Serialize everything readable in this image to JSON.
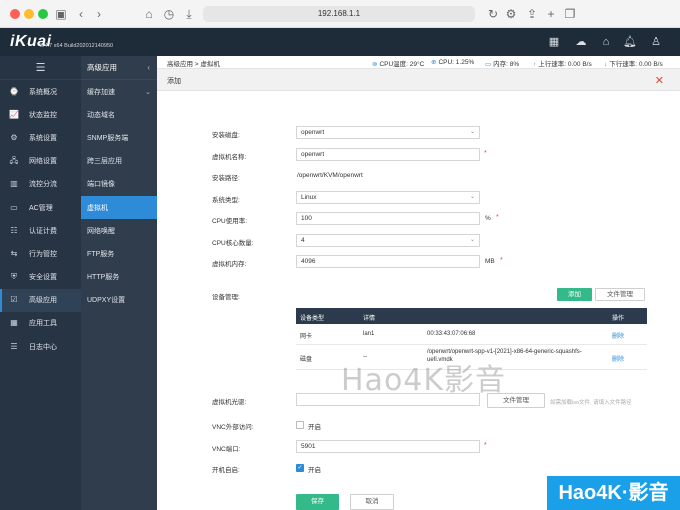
{
  "browser": {
    "url": "192.168.1.1"
  },
  "app": {
    "logo": "iKuai",
    "version": "3.4.7 x64 Build202012140950"
  },
  "sidebar": {
    "items": [
      {
        "label": "系统概况",
        "icon": "⌚"
      },
      {
        "label": "状态监控",
        "icon": "📈"
      },
      {
        "label": "系统设置",
        "icon": "⚙"
      },
      {
        "label": "网络设置",
        "icon": "🖧"
      },
      {
        "label": "流控分流",
        "icon": "▥"
      },
      {
        "label": "AC管理",
        "icon": "▭"
      },
      {
        "label": "认证计费",
        "icon": "☷"
      },
      {
        "label": "行为管控",
        "icon": "⇆"
      },
      {
        "label": "安全设置",
        "icon": "⛨"
      },
      {
        "label": "高级应用",
        "icon": "☑"
      },
      {
        "label": "应用工具",
        "icon": "▦"
      },
      {
        "label": "日志中心",
        "icon": "☰"
      }
    ]
  },
  "submenu": {
    "title": "高级应用",
    "items": [
      "缓存加速",
      "动态域名",
      "SNMP服务端",
      "跨三层应用",
      "端口镜像",
      "虚拟机",
      "网络唤醒",
      "FTP服务",
      "HTTP服务",
      "UDPXY设置"
    ]
  },
  "statusbar": {
    "breadcrumb": "高级应用 > 虚拟机",
    "cpu_temp": "CPU温度: 29°C",
    "cpu": "CPU: 1.25%",
    "mem": "内存: 8%",
    "up": "上行速率: 0.00 B/s",
    "down": "下行速率: 0.00 B/s"
  },
  "panel": {
    "title": "添加"
  },
  "form": {
    "disk_label": "安装磁盘:",
    "disk_value": "openwrt",
    "name_label": "虚拟机名称:",
    "name_value": "openwrt",
    "path_label": "安装路径:",
    "path_value": "/openwrt/KVM/openwrt",
    "os_label": "系统类型:",
    "os_value": "Linux",
    "cpu_label": "CPU使用率:",
    "cpu_value": "100",
    "cpu_unit": "%",
    "cores_label": "CPU核心数量:",
    "cores_value": "4",
    "mem_label": "虚拟机内存:",
    "mem_value": "4096",
    "mem_unit": "MB",
    "dev_label": "设备管理:",
    "add_btn": "添加",
    "filemgr_btn": "文件管理",
    "table_headers": [
      "设备类型",
      "详情",
      "操作"
    ],
    "rows": [
      {
        "type": "网卡",
        "detail1": "lan1",
        "detail2": "00:33:43:07:06:68",
        "op": "删除"
      },
      {
        "type": "磁盘",
        "detail1": "--",
        "detail2a": "/openwrt/openwrt-spp-v1-[2021]-x86-64-generic-squashfs-",
        "detail2b": "uefi.vmdk",
        "op": "删除"
      }
    ],
    "cdrom_label": "虚拟机光驱:",
    "cdrom_btn": "文件管理",
    "cdrom_hint": "如需加载iso文件, 请填入文件路径",
    "vnc_ext_label": "VNC外部访问:",
    "vnc_ext_text": "开启",
    "vnc_port_label": "VNC端口:",
    "vnc_port_value": "5901",
    "autostart_label": "开机自启:",
    "autostart_text": "开启",
    "save_btn": "保存",
    "cancel_btn": "取消"
  },
  "watermark": {
    "center": "Hao4K影音",
    "corner": "Hao4K·影音"
  },
  "colors": {
    "accent": "#2e8bd8",
    "green": "#34b98b",
    "sidebar": "#273444",
    "header": "#1e2b38"
  }
}
